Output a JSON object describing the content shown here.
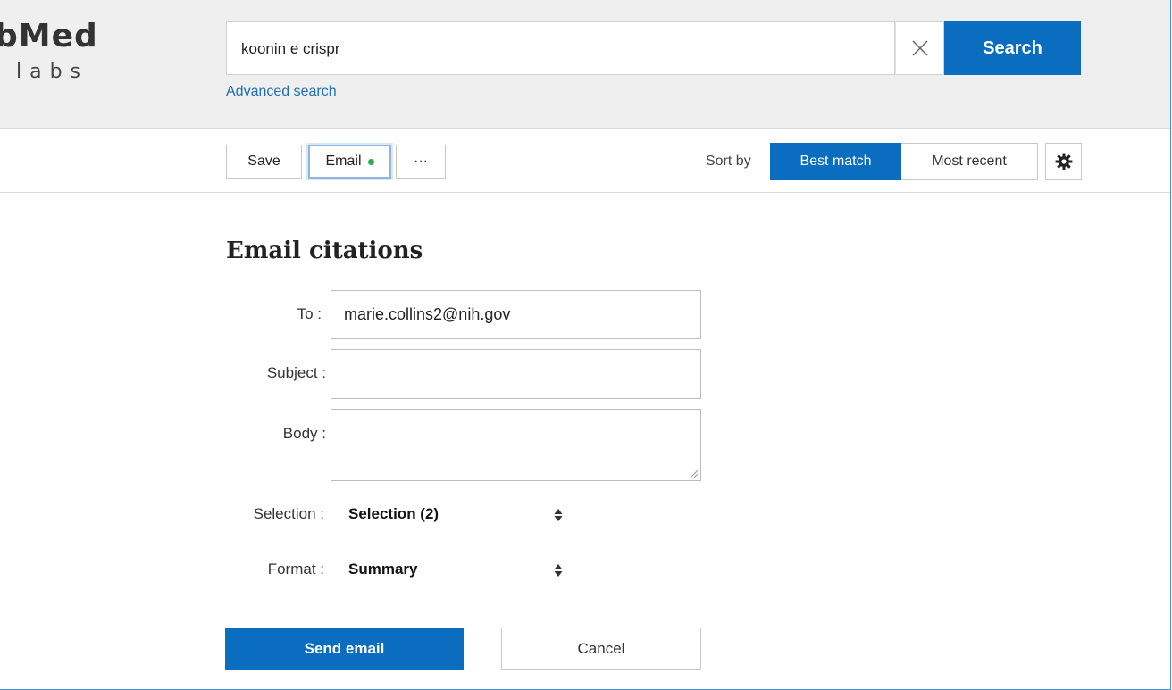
{
  "logo": {
    "main": "bMed",
    "sub": "labs"
  },
  "search": {
    "value": "koonin e crispr",
    "button_label": "Search",
    "advanced_link": "Advanced search",
    "clear_icon": "close-icon"
  },
  "toolbar": {
    "save_label": "Save",
    "email_label": "Email",
    "more_label": "···"
  },
  "sort": {
    "label": "Sort by",
    "options": [
      {
        "label": "Best match",
        "active": true
      },
      {
        "label": "Most recent",
        "active": false
      }
    ],
    "settings_icon": "gear-icon"
  },
  "email_form": {
    "title": "Email citations",
    "to_label": "To :",
    "to_value": "marie.collins2@nih.gov",
    "subject_label": "Subject :",
    "subject_value": "",
    "body_label": "Body :",
    "body_value": "",
    "selection_label": "Selection :",
    "selection_value": "Selection (2)",
    "format_label": "Format :",
    "format_value": "Summary",
    "send_label": "Send email",
    "cancel_label": "Cancel"
  },
  "colors": {
    "accent": "#0b6dbf",
    "header_bg": "#efefef",
    "link": "#1f6fb2",
    "status_dot": "#2eaa4f"
  }
}
